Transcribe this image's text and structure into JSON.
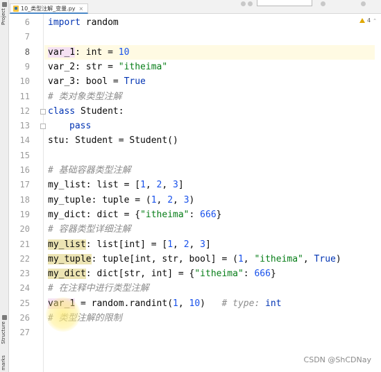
{
  "tab": {
    "filename": "10_类型注解_变量.py",
    "close": "×"
  },
  "side_panels": {
    "project": "Project",
    "structure": "Structure",
    "bookmarks": "marks"
  },
  "inspection": {
    "warning_count": "4"
  },
  "line_numbers": [
    "6",
    "7",
    "8",
    "9",
    "10",
    "11",
    "12",
    "13",
    "14",
    "15",
    "16",
    "17",
    "18",
    "19",
    "20",
    "21",
    "22",
    "23",
    "24",
    "25",
    "26",
    "27"
  ],
  "code": {
    "l6": {
      "kw": "import",
      "rest": " random"
    },
    "l8": {
      "var_a": "var",
      "var_b": "_1",
      "mid": ": int = ",
      "num": "10"
    },
    "l9": {
      "pre": "var_2: str = ",
      "str": "\"itheima\""
    },
    "l10": {
      "pre": "var_3: bool = ",
      "kw": "True"
    },
    "l11": {
      "cmt": "# 类对象类型注解"
    },
    "l12": {
      "kw": "class",
      "rest": " Student:"
    },
    "l13": {
      "kw": "pass"
    },
    "l14": {
      "text": "stu: Student = Student()"
    },
    "l16": {
      "cmt": "# 基础容器类型注解"
    },
    "l17": {
      "pre": "my_list: list = [",
      "n1": "1",
      "s1": ", ",
      "n2": "2",
      "s2": ", ",
      "n3": "3",
      "end": "]"
    },
    "l18": {
      "pre": "my_tuple: tuple = (",
      "n1": "1",
      "s1": ", ",
      "n2": "2",
      "s2": ", ",
      "n3": "3",
      "end": ")"
    },
    "l19": {
      "pre": "my_dict: dict = {",
      "str": "\"itheima\"",
      "sep": ": ",
      "num": "666",
      "end": "}"
    },
    "l20": {
      "cmt": "# 容器类型详细注解"
    },
    "l21": {
      "var": "my_list",
      "pre": ": list[int] = [",
      "n1": "1",
      "s1": ", ",
      "n2": "2",
      "s2": ", ",
      "n3": "3",
      "end": "]"
    },
    "l22": {
      "var": "my_tuple",
      "pre": ": tuple[int, str, bool] = (",
      "n1": "1",
      "s1": ", ",
      "str": "\"itheima\"",
      "s2": ", ",
      "kw": "True",
      "end": ")"
    },
    "l23": {
      "var": "my_dict",
      "pre": ": dict[str, int] = {",
      "str": "\"itheima\"",
      "sep": ": ",
      "num": "666",
      "end": "}"
    },
    "l24": {
      "cmt": "# 在注释中进行类型注解"
    },
    "l25": {
      "var": "var_1",
      "pre": " = random.randint(",
      "n1": "1",
      "s1": ", ",
      "n2": "10",
      "end": ")",
      "gap": "   ",
      "cmt": "# type: ",
      "type": "int"
    },
    "l26": {
      "cmt": "# 类型注解的限制"
    }
  },
  "watermark": "CSDN @ShCDNay"
}
